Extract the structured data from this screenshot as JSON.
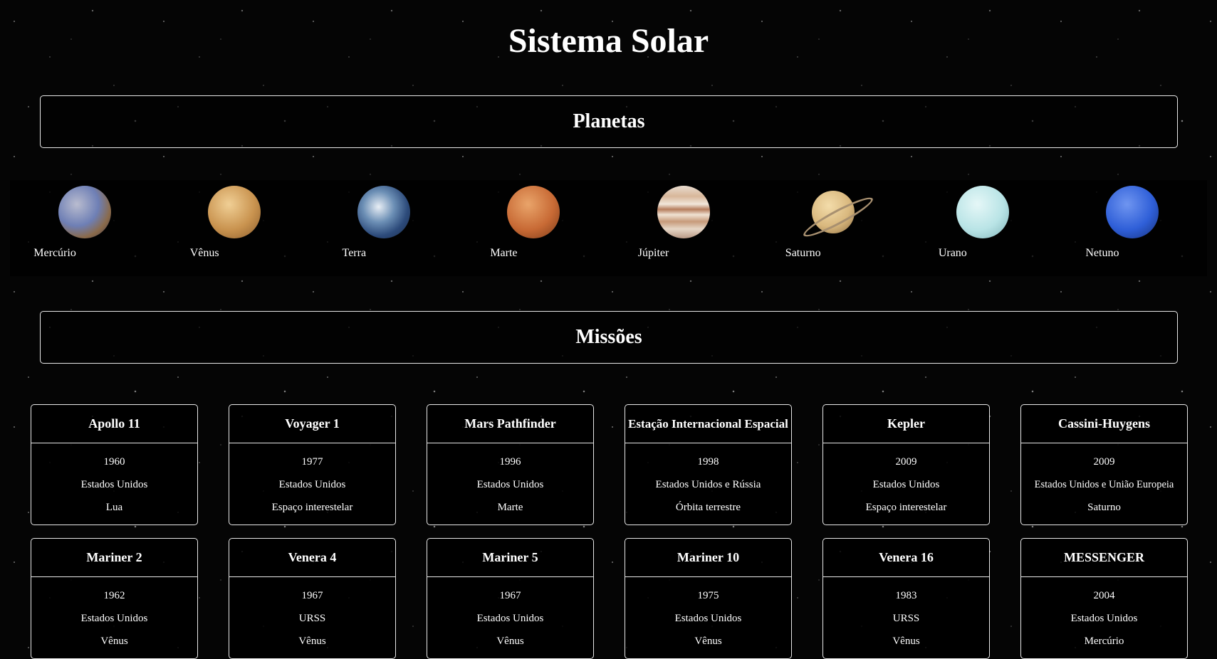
{
  "title": "Sistema Solar",
  "sections": {
    "planetas": "Planetas",
    "missoes": "Missões"
  },
  "planets": [
    {
      "name": "Mercúrio",
      "color": "#7d7fa0"
    },
    {
      "name": "Vênus",
      "color": "#c9934f"
    },
    {
      "name": "Terra",
      "color": "#3b5f8c"
    },
    {
      "name": "Marte",
      "color": "#c86a35"
    },
    {
      "name": "Júpiter",
      "color": "#d8b79a"
    },
    {
      "name": "Saturno",
      "color": "#d9b87e"
    },
    {
      "name": "Urano",
      "color": "#b9e4e6"
    },
    {
      "name": "Netuno",
      "color": "#2f5fd8"
    }
  ],
  "missions": [
    {
      "name": "Apollo 11",
      "year": "1960",
      "country": "Estados Unidos",
      "target": "Lua"
    },
    {
      "name": "Voyager 1",
      "year": "1977",
      "country": "Estados Unidos",
      "target": "Espaço interestelar"
    },
    {
      "name": "Mars Pathfinder",
      "year": "1996",
      "country": "Estados Unidos",
      "target": "Marte"
    },
    {
      "name": "Estação Internacional Espacial",
      "year": "1998",
      "country": "Estados Unidos e Rússia",
      "target": "Órbita terrestre"
    },
    {
      "name": "Kepler",
      "year": "2009",
      "country": "Estados Unidos",
      "target": "Espaço interestelar"
    },
    {
      "name": "Cassini-Huygens",
      "year": "2009",
      "country": "Estados Unidos e União Europeia",
      "target": "Saturno"
    },
    {
      "name": "Mariner 2",
      "year": "1962",
      "country": "Estados Unidos",
      "target": "Vênus"
    },
    {
      "name": "Venera 4",
      "year": "1967",
      "country": "URSS",
      "target": "Vênus"
    },
    {
      "name": "Mariner 5",
      "year": "1967",
      "country": "Estados Unidos",
      "target": "Vênus"
    },
    {
      "name": "Mariner 10",
      "year": "1975",
      "country": "Estados Unidos",
      "target": "Vênus"
    },
    {
      "name": "Venera 16",
      "year": "1983",
      "country": "URSS",
      "target": "Vênus"
    },
    {
      "name": "MESSENGER",
      "year": "2004",
      "country": "Estados Unidos",
      "target": "Mercúrio"
    }
  ]
}
